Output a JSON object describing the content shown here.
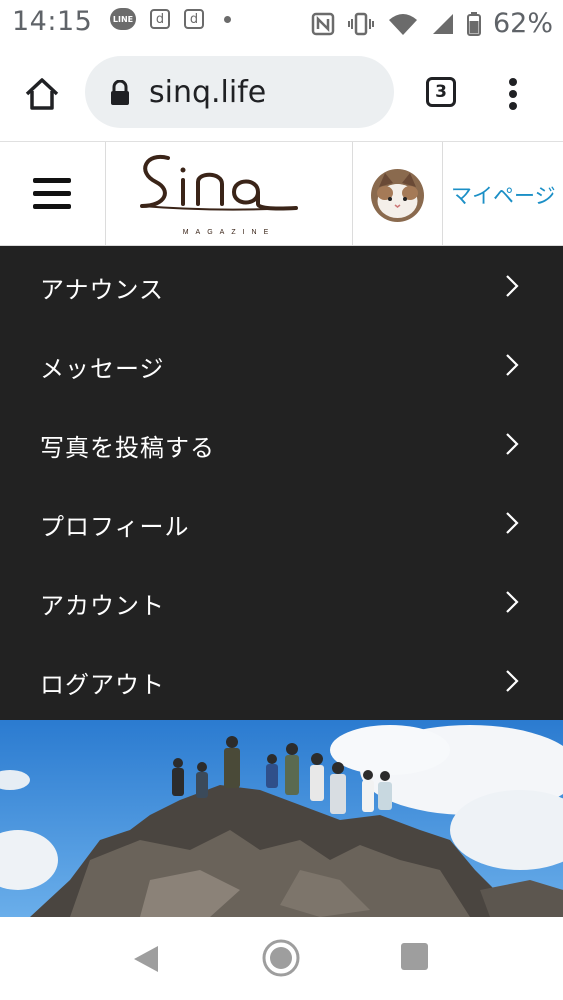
{
  "status_bar": {
    "time": "14:15",
    "line_badge": "LINE",
    "d_badge_1": "d",
    "d_badge_2": "d",
    "battery_percent": "62%"
  },
  "browser": {
    "url": "sinq.life",
    "tab_count": "3"
  },
  "site_header": {
    "logo_text": "Sinq",
    "logo_subtext": "MAGAZINE",
    "mypage_label": "マイページ"
  },
  "menu": {
    "items": [
      {
        "label": "アナウンス"
      },
      {
        "label": "メッセージ"
      },
      {
        "label": "写真を投稿する"
      },
      {
        "label": "プロフィール"
      },
      {
        "label": "アカウント"
      },
      {
        "label": "ログアウト"
      }
    ]
  },
  "colors": {
    "menu_bg": "#222222",
    "accent": "#1b8fc6",
    "url_bg": "#eceff1"
  }
}
